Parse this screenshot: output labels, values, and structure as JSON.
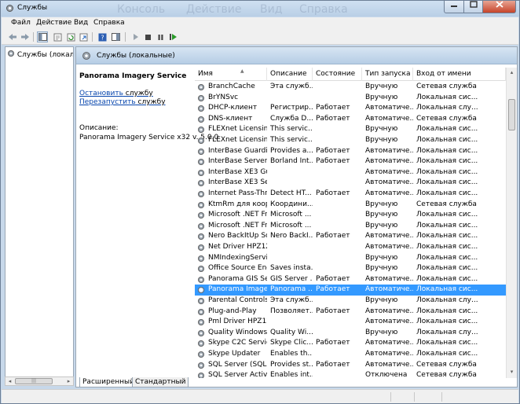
{
  "window": {
    "title": "Службы",
    "ghost_menu": [
      "Консоль",
      "Действие",
      "Вид",
      "Справка"
    ]
  },
  "menu": [
    "Файл",
    "Действие",
    "Вид",
    "Справка"
  ],
  "tree": {
    "item": "Службы (локальны"
  },
  "header": {
    "title": "Службы (локальные)"
  },
  "details": {
    "service_name": "Panorama Imagery Service",
    "stop_link": "Остановить",
    "stop_rest": " службу",
    "restart_link": "Перезапустить",
    "restart_rest": " службу",
    "description_label": "Описание:",
    "description_text": "Panorama Imagery Service x32 v. 5.0.0"
  },
  "columns": [
    "Имя",
    "Описание",
    "Состояние",
    "Тип запуска",
    "Вход от имени"
  ],
  "rows": [
    {
      "name": "BranchCache",
      "desc": "Эта служб...",
      "state": "",
      "start": "Вручную",
      "logon": "Сетевая служба"
    },
    {
      "name": "BrYNSvc",
      "desc": "",
      "state": "",
      "start": "Вручную",
      "logon": "Локальная сис..."
    },
    {
      "name": "DHCP-клиент",
      "desc": "Регистрир...",
      "state": "Работает",
      "start": "Автоматиче...",
      "logon": "Локальная слу..."
    },
    {
      "name": "DNS-клиент",
      "desc": "Служба D...",
      "state": "Работает",
      "start": "Автоматиче...",
      "logon": "Сетевая служба"
    },
    {
      "name": "FLEXnet Licensing...",
      "desc": "This servic...",
      "state": "",
      "start": "Вручную",
      "logon": "Локальная сис..."
    },
    {
      "name": "FLEXnet Licensing...",
      "desc": "This servic...",
      "state": "",
      "start": "Вручную",
      "logon": "Локальная сис..."
    },
    {
      "name": "InterBase Guardian",
      "desc": "Provides a...",
      "state": "Работает",
      "start": "Автоматиче...",
      "logon": "Локальная сис..."
    },
    {
      "name": "InterBase Server",
      "desc": "Borland Int...",
      "state": "Работает",
      "start": "Автоматиче...",
      "logon": "Локальная сис..."
    },
    {
      "name": "InterBase XE3 Gua...",
      "desc": "",
      "state": "",
      "start": "Автоматиче...",
      "logon": "Локальная сис..."
    },
    {
      "name": "InterBase XE3 Serv...",
      "desc": "",
      "state": "",
      "start": "Автоматиче...",
      "logon": "Локальная сис..."
    },
    {
      "name": "Internet Pass-Thro...",
      "desc": "Detect HT...",
      "state": "Работает",
      "start": "Автоматиче...",
      "logon": "Локальная сис..."
    },
    {
      "name": "KtmRm для коор...",
      "desc": "Координи...",
      "state": "",
      "start": "Вручную",
      "logon": "Сетевая служба"
    },
    {
      "name": "Microsoft .NET Fr...",
      "desc": "Microsoft ...",
      "state": "",
      "start": "Вручную",
      "logon": "Локальная сис..."
    },
    {
      "name": "Microsoft .NET Fr...",
      "desc": "Microsoft ...",
      "state": "",
      "start": "Вручную",
      "logon": "Локальная сис..."
    },
    {
      "name": "Nero BackItUp Sc...",
      "desc": "Nero BackI...",
      "state": "Работает",
      "start": "Автоматиче...",
      "logon": "Локальная сис..."
    },
    {
      "name": "Net Driver HPZ12",
      "desc": "",
      "state": "",
      "start": "Автоматиче...",
      "logon": "Локальная сис..."
    },
    {
      "name": "NMIndexingService",
      "desc": "",
      "state": "",
      "start": "Вручную",
      "logon": "Локальная сис..."
    },
    {
      "name": "Office Source Engi...",
      "desc": "Saves insta...",
      "state": "",
      "start": "Вручную",
      "logon": "Локальная сис..."
    },
    {
      "name": "Panorama GIS Ser...",
      "desc": "GIS Server ...",
      "state": "Работает",
      "start": "Автоматиче...",
      "logon": "Локальная сис..."
    },
    {
      "name": "Panorama Imager...",
      "desc": "Panorama ...",
      "state": "Работает",
      "start": "Автоматиче...",
      "logon": "Локальная сис...",
      "selected": true
    },
    {
      "name": "Parental Controls",
      "desc": "Эта служб...",
      "state": "",
      "start": "Вручную",
      "logon": "Локальная слу..."
    },
    {
      "name": "Plug-and-Play",
      "desc": "Позволяет...",
      "state": "Работает",
      "start": "Автоматиче...",
      "logon": "Локальная сис..."
    },
    {
      "name": "Pml Driver HPZ12",
      "desc": "",
      "state": "",
      "start": "Автоматиче...",
      "logon": "Локальная сис..."
    },
    {
      "name": "Quality Windows ...",
      "desc": "Quality Wi...",
      "state": "",
      "start": "Вручную",
      "logon": "Локальная слу..."
    },
    {
      "name": "Skype C2C Service",
      "desc": "Skype Clic...",
      "state": "Работает",
      "start": "Автоматиче...",
      "logon": "Локальная сис..."
    },
    {
      "name": "Skype Updater",
      "desc": "Enables th...",
      "state": "",
      "start": "Автоматиче...",
      "logon": "Локальная сис..."
    },
    {
      "name": "SQL Server (SQLEX...",
      "desc": "Provides st...",
      "state": "Работает",
      "start": "Автоматиче...",
      "logon": "Сетевая служба"
    },
    {
      "name": "SQL Server Active...",
      "desc": "Enables int...",
      "state": "",
      "start": "Отключена",
      "logon": "Сетевая служба"
    }
  ],
  "tabs": [
    "Расширенный",
    "Стандартный"
  ],
  "scroll": {
    "left_arrow": "◂",
    "right_arrow": "▸",
    "grip": "|||",
    "up_arrow": "▴",
    "down_arrow": "▾"
  },
  "icons": {
    "gear": "gear-icon",
    "services": "services-icon"
  },
  "colors": {
    "selection": "#3399ff",
    "link": "#0645ad",
    "close": "#c7442a"
  }
}
